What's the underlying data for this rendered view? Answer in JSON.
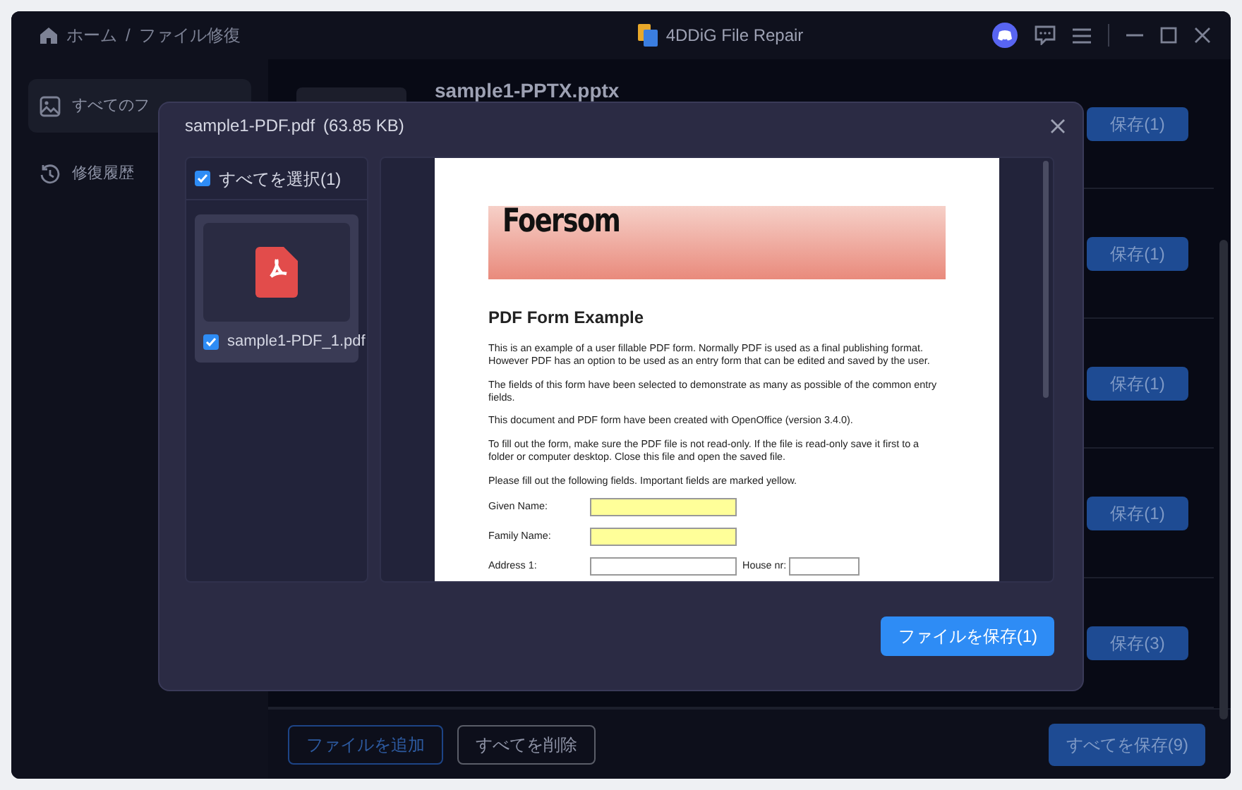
{
  "window": {
    "title": "4DDiG File Repair"
  },
  "breadcrumb": {
    "items": [
      "ホーム",
      "ファイル修復"
    ],
    "separator": "/"
  },
  "sidebar": {
    "items": [
      {
        "label": "すべてのフ",
        "kind": "images",
        "selected": true
      },
      {
        "label": "修復履歴",
        "kind": "history",
        "selected": false
      }
    ]
  },
  "file_list": {
    "rows": [
      {
        "name": "sample1-PPTX.pptx",
        "save_button": "保存(1)"
      },
      {
        "save_button": "保存(1)"
      },
      {
        "save_button": "保存(1)"
      },
      {
        "save_button": "保存(1)"
      },
      {
        "save_button": "保存(3)"
      }
    ]
  },
  "footer": {
    "add_button": "ファイルを追加",
    "delete_button": "すべてを削除",
    "save_all_button": "すべてを保存(9)"
  },
  "dialog": {
    "title": "sample1-PDF.pdf",
    "size": "(63.85 KB)",
    "select_all": {
      "label": "すべてを選択(1)",
      "checked": true
    },
    "files": [
      {
        "name": "sample1-PDF_1.pdf",
        "checked": true,
        "selected": true
      }
    ],
    "document": {
      "logo": "Foersom",
      "heading": "PDF Form Example",
      "paragraphs": [
        "This is an example of a user fillable PDF form. Normally PDF is used as a final publishing format. However PDF has an option to be used as an entry form that can be edited and saved by the user.",
        "The fields of this form have been selected to demonstrate as many as possible of the common entry fields.",
        "This document and PDF form have been created with OpenOffice (version 3.4.0).",
        "To fill out the form, make sure the PDF file is not read-only. If the file is read-only save it first to a folder or computer desktop. Close this file and open the saved file.",
        "Please fill out the following fields. Important fields are marked yellow."
      ],
      "fields": [
        {
          "label": "Given Name:",
          "required": true
        },
        {
          "label": "Family Name:",
          "required": true
        },
        {
          "label": "Address 1:",
          "required": false,
          "extra_label": "House nr:"
        }
      ]
    },
    "save_button": "ファイルを保存(1)"
  }
}
